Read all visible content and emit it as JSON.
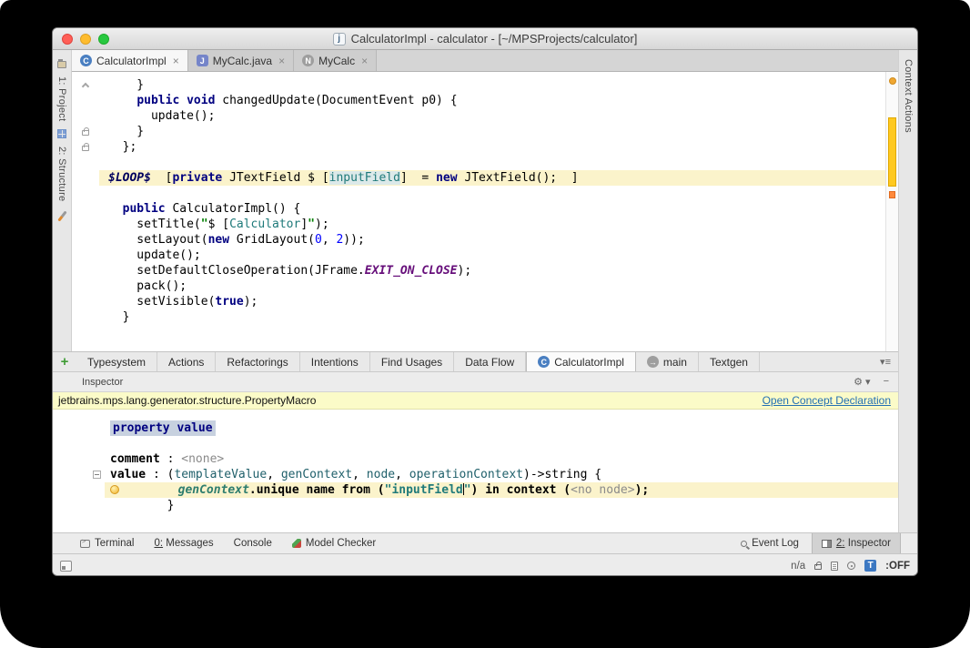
{
  "window": {
    "title": "CalculatorImpl - calculator - [~/MPSProjects/calculator]",
    "app_icon_letter": "j"
  },
  "left_stripe": {
    "project": "1: Project",
    "structure": "2: Structure"
  },
  "right_stripe": {
    "context_actions": "Context Actions"
  },
  "editor_tabs": [
    {
      "label": "CalculatorImpl",
      "icon_letter": "C",
      "close": "×"
    },
    {
      "label": "MyCalc.java",
      "icon_letter": "J",
      "close": "×"
    },
    {
      "label": "MyCalc",
      "icon_letter": "N",
      "close": "×"
    }
  ],
  "tool_tabs": {
    "add_button": "+",
    "plain": [
      "Typesystem",
      "Actions",
      "Refactorings",
      "Intentions",
      "Find Usages",
      "Data Flow"
    ],
    "calculator": {
      "label": "CalculatorImpl",
      "icon_letter": "C"
    },
    "main": {
      "label": "main",
      "icon_letter": "→"
    },
    "textgen": {
      "label": "Textgen"
    },
    "more_icon": "▾≡"
  },
  "editor": {
    "lines": [
      {
        "gutter": "fold",
        "s": [
          [
            "pl",
            "    }"
          ]
        ]
      },
      {
        "s": [
          [
            "pl",
            "    "
          ],
          [
            "kw",
            "public"
          ],
          [
            "pl",
            " "
          ],
          [
            "kw",
            "void"
          ],
          [
            "pl",
            " changedUpdate(DocumentEvent p0) {"
          ]
        ]
      },
      {
        "s": [
          [
            "pl",
            "      update();"
          ]
        ]
      },
      {
        "gutter": "lock",
        "s": [
          [
            "pl",
            "    }"
          ]
        ]
      },
      {
        "gutter": "lock",
        "s": [
          [
            "pl",
            "  };"
          ]
        ]
      },
      {
        "s": []
      },
      {
        "hl": true,
        "s": [
          [
            "mac",
            "$LOOP$"
          ],
          [
            "pl",
            "  ["
          ],
          [
            "kw",
            "private"
          ],
          [
            "pl",
            " JTextField "
          ],
          [
            "pl",
            "$ ["
          ],
          [
            "refbg",
            "inputField"
          ],
          [
            "pl",
            "]  = "
          ],
          [
            "kw",
            "new"
          ],
          [
            "pl",
            " JTextField();  ]"
          ]
        ]
      },
      {
        "s": []
      },
      {
        "s": [
          [
            "pl",
            "  "
          ],
          [
            "kw",
            "public"
          ],
          [
            "pl",
            " CalculatorImpl() {"
          ]
        ]
      },
      {
        "s": [
          [
            "pl",
            "    setTitle("
          ],
          [
            "str",
            "\""
          ],
          [
            "pl",
            "$ ["
          ],
          [
            "ref",
            "Calculator"
          ],
          [
            "pl",
            "]"
          ],
          [
            "str",
            "\""
          ],
          [
            "pl",
            ");"
          ]
        ]
      },
      {
        "s": [
          [
            "pl",
            "    setLayout("
          ],
          [
            "kw",
            "new"
          ],
          [
            "pl",
            " GridLayout("
          ],
          [
            "num",
            "0"
          ],
          [
            "pl",
            ", "
          ],
          [
            "num",
            "2"
          ],
          [
            "pl",
            "));"
          ]
        ]
      },
      {
        "s": [
          [
            "pl",
            "    update();"
          ]
        ]
      },
      {
        "s": [
          [
            "pl",
            "    setDefaultCloseOperation(JFrame."
          ],
          [
            "cst",
            "EXIT_ON_CLOSE"
          ],
          [
            "pl",
            ");"
          ]
        ]
      },
      {
        "s": [
          [
            "pl",
            "    pack();"
          ]
        ]
      },
      {
        "s": [
          [
            "pl",
            "    setVisible("
          ],
          [
            "kw",
            "true"
          ],
          [
            "pl",
            ");"
          ]
        ]
      },
      {
        "s": [
          [
            "pl",
            "  }"
          ]
        ]
      }
    ]
  },
  "inspector": {
    "header": "Inspector",
    "gear_icon": "⚙ ▾",
    "hide_icon": "−",
    "banner": {
      "left": "jetbrains.mps.lang.generator.structure.PropertyMacro",
      "link": "Open Concept Declaration"
    },
    "lines": [
      {
        "s": [
          [
            "selkw",
            "property value"
          ]
        ]
      },
      {
        "s": []
      },
      {
        "s": [
          [
            "b",
            "comment"
          ],
          [
            "pl",
            " : "
          ],
          [
            "dim",
            "<none>"
          ]
        ]
      },
      {
        "gutter": "minus",
        "s": [
          [
            "b",
            "value"
          ],
          [
            "pl",
            " : ("
          ],
          [
            "prm",
            "templateValue"
          ],
          [
            "pl",
            ", "
          ],
          [
            "prm",
            "genContext"
          ],
          [
            "pl",
            ", "
          ],
          [
            "prm",
            "node"
          ],
          [
            "pl",
            ", "
          ],
          [
            "prm",
            "operationContext"
          ],
          [
            "pl",
            ")->string {"
          ]
        ]
      },
      {
        "hl": true,
        "s": [
          [
            "bulb",
            ""
          ],
          [
            "pl",
            "        "
          ],
          [
            "it",
            "genContext"
          ],
          [
            "b",
            ".unique name from ("
          ],
          [
            "strT",
            "\"inputField"
          ],
          [
            "caret",
            ""
          ],
          [
            "strT",
            "\""
          ],
          [
            "b",
            ") in context ("
          ],
          [
            "dim",
            "<no node>"
          ],
          [
            "b",
            ");"
          ]
        ]
      },
      {
        "s": [
          [
            "pl",
            "        }"
          ]
        ]
      }
    ]
  },
  "status_bar": {
    "terminal": "Terminal",
    "messages": "0: Messages",
    "console": "Console",
    "model_checker": "Model Checker",
    "event_log": "Event Log",
    "inspector": "2: Inspector"
  },
  "bottom_bar": {
    "na": "n/a",
    "t_badge": "T",
    "t_state": ":OFF"
  }
}
